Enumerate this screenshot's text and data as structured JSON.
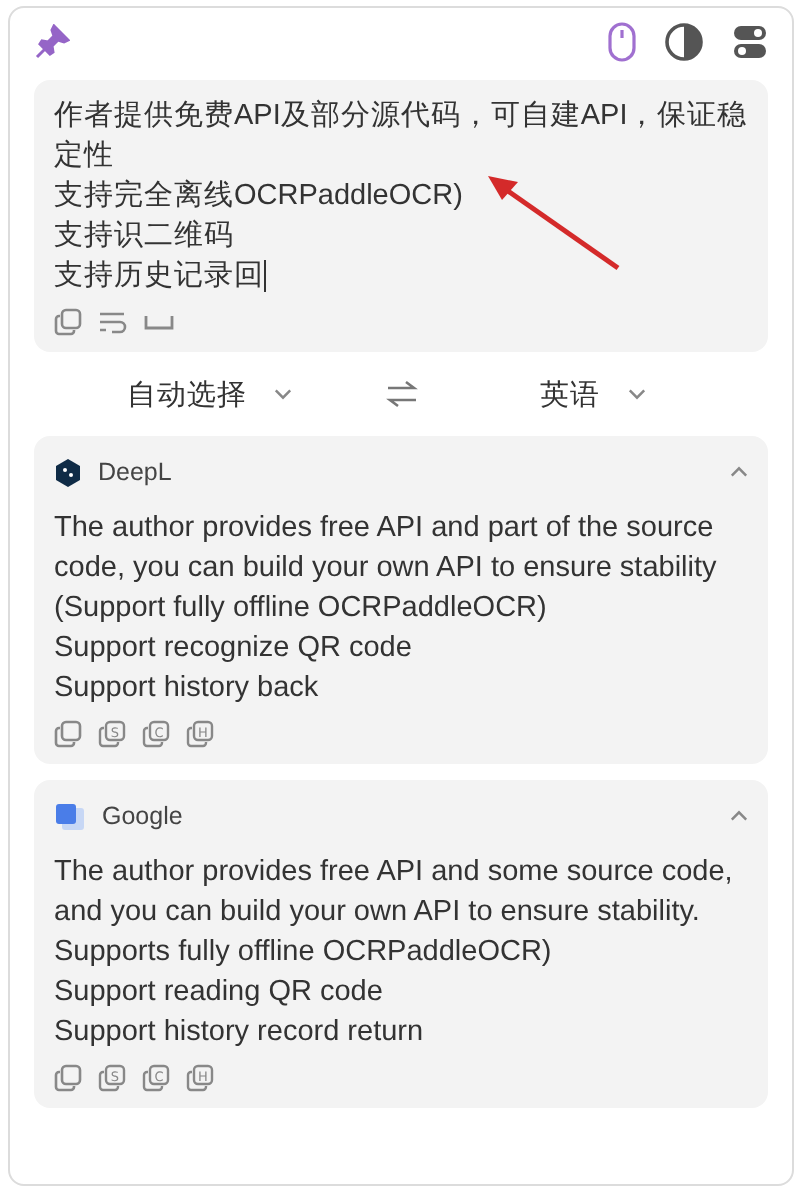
{
  "toolbar": {
    "pinned": true,
    "mouse_selected": true
  },
  "source": {
    "lines": [
      "作者提供免费API及部分源代码，可自建API，保证稳定性",
      "支持完全离线OCRPaddleOCR)",
      "支持识二维码",
      "支持历史记录回"
    ],
    "cursor": true
  },
  "languages": {
    "from": "自动选择",
    "to": "英语"
  },
  "results": [
    {
      "kind": "deepl",
      "service": "DeepL",
      "expanded": true,
      "lines": [
        "The author provides free API and part of the source code, you can build your own API to ensure stability",
        "(Support fully offline OCRPaddleOCR)",
        "Support recognize QR code",
        "Support history back"
      ],
      "actions": [
        "S",
        "C",
        "H"
      ]
    },
    {
      "kind": "google",
      "service": "Google",
      "expanded": true,
      "lines": [
        "The author provides free API and some source code, and you can build your own API to ensure stability.",
        "Supports fully offline OCRPaddleOCR)",
        "Support reading QR code",
        "Support history record return"
      ],
      "actions": [
        "S",
        "C",
        "H"
      ]
    }
  ]
}
